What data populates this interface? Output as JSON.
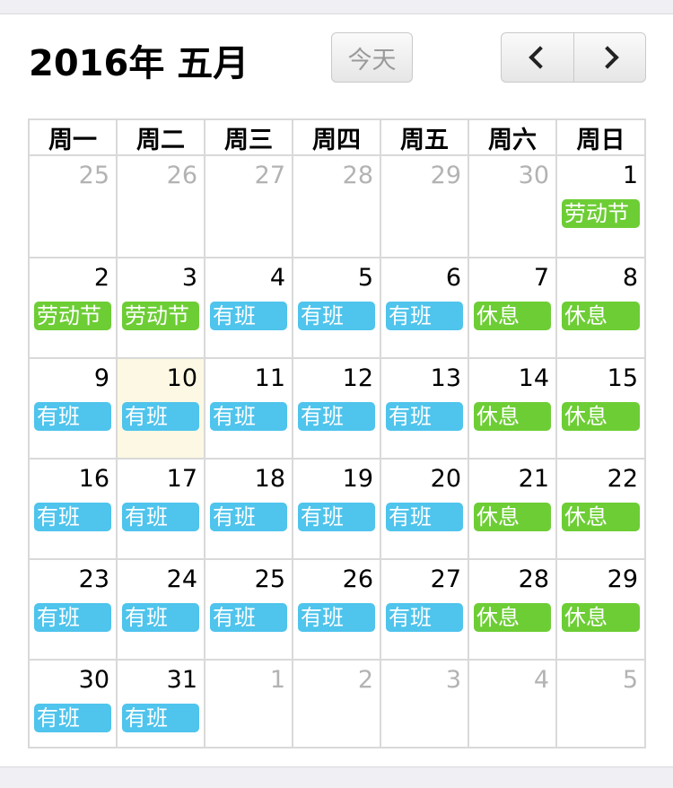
{
  "header": {
    "title": "2016年 五月",
    "today_label": "今天"
  },
  "colors": {
    "holiday": "#6dcd35",
    "work": "#4fc4ec",
    "rest": "#6dcd35",
    "today_bg": "#fcf8e3"
  },
  "weekdays": [
    "周一",
    "周二",
    "周三",
    "周四",
    "周五",
    "周六",
    "周日"
  ],
  "weeks": [
    [
      {
        "day": "25",
        "other": true
      },
      {
        "day": "26",
        "other": true
      },
      {
        "day": "27",
        "other": true
      },
      {
        "day": "28",
        "other": true
      },
      {
        "day": "29",
        "other": true
      },
      {
        "day": "30",
        "other": true
      },
      {
        "day": "1",
        "event": "劳动节",
        "type": "holiday"
      }
    ],
    [
      {
        "day": "2",
        "event": "劳动节",
        "type": "holiday"
      },
      {
        "day": "3",
        "event": "劳动节",
        "type": "holiday"
      },
      {
        "day": "4",
        "event": "有班",
        "type": "work"
      },
      {
        "day": "5",
        "event": "有班",
        "type": "work"
      },
      {
        "day": "6",
        "event": "有班",
        "type": "work"
      },
      {
        "day": "7",
        "event": "休息",
        "type": "rest"
      },
      {
        "day": "8",
        "event": "休息",
        "type": "rest"
      }
    ],
    [
      {
        "day": "9",
        "event": "有班",
        "type": "work"
      },
      {
        "day": "10",
        "event": "有班",
        "type": "work",
        "today": true
      },
      {
        "day": "11",
        "event": "有班",
        "type": "work"
      },
      {
        "day": "12",
        "event": "有班",
        "type": "work"
      },
      {
        "day": "13",
        "event": "有班",
        "type": "work"
      },
      {
        "day": "14",
        "event": "休息",
        "type": "rest"
      },
      {
        "day": "15",
        "event": "休息",
        "type": "rest"
      }
    ],
    [
      {
        "day": "16",
        "event": "有班",
        "type": "work"
      },
      {
        "day": "17",
        "event": "有班",
        "type": "work"
      },
      {
        "day": "18",
        "event": "有班",
        "type": "work"
      },
      {
        "day": "19",
        "event": "有班",
        "type": "work"
      },
      {
        "day": "20",
        "event": "有班",
        "type": "work"
      },
      {
        "day": "21",
        "event": "休息",
        "type": "rest"
      },
      {
        "day": "22",
        "event": "休息",
        "type": "rest"
      }
    ],
    [
      {
        "day": "23",
        "event": "有班",
        "type": "work"
      },
      {
        "day": "24",
        "event": "有班",
        "type": "work"
      },
      {
        "day": "25",
        "event": "有班",
        "type": "work"
      },
      {
        "day": "26",
        "event": "有班",
        "type": "work"
      },
      {
        "day": "27",
        "event": "有班",
        "type": "work"
      },
      {
        "day": "28",
        "event": "休息",
        "type": "rest"
      },
      {
        "day": "29",
        "event": "休息",
        "type": "rest"
      }
    ],
    [
      {
        "day": "30",
        "event": "有班",
        "type": "work"
      },
      {
        "day": "31",
        "event": "有班",
        "type": "work"
      },
      {
        "day": "1",
        "other": true
      },
      {
        "day": "2",
        "other": true
      },
      {
        "day": "3",
        "other": true
      },
      {
        "day": "4",
        "other": true
      },
      {
        "day": "5",
        "other": true
      }
    ]
  ]
}
